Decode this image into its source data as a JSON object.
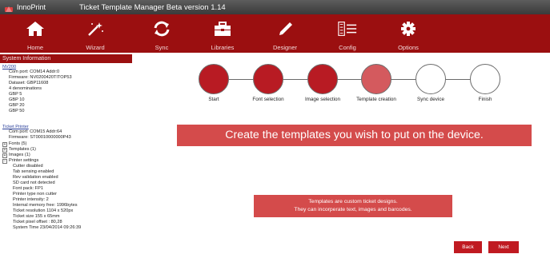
{
  "window": {
    "app_name": "InnoPrint",
    "title": "Ticket Template Manager Beta version 1.14"
  },
  "toolbar": {
    "items": [
      {
        "label": "Home",
        "icon": "home-icon"
      },
      {
        "label": "Wizard",
        "icon": "wand-icon"
      },
      {
        "label": "Sync",
        "icon": "sync-icon"
      },
      {
        "label": "Libraries",
        "icon": "briefcase-icon"
      },
      {
        "label": "Designer",
        "icon": "pen-icon"
      },
      {
        "label": "Config",
        "icon": "config-list-icon"
      },
      {
        "label": "Options",
        "icon": "gear-icon"
      }
    ]
  },
  "sidebar": {
    "header": "System Information",
    "nv200": {
      "title": "NV200",
      "lines": [
        "Com port: COM14 Addr:0",
        "Firmware: NV0200420TITOP53",
        "Dataset: GBP11608",
        "4 denominations",
        "GBP 5",
        "GBP 10",
        "GBP 20",
        "GBP 50"
      ]
    },
    "printer": {
      "title": "Ticket Printer",
      "lines": [
        "Com port: COM15 Addr:64",
        "Firmware: ST00010000000P43"
      ],
      "tree": [
        "Fonts (5)",
        "Templates (1)",
        "Images (1)",
        "Printer settings"
      ],
      "settings": [
        "Cutter disabled",
        "Tab sensing enabled",
        "Rev validation enabled",
        "SD card not detected",
        "Font pack: FP1",
        "Printer type non cutter",
        "Printer intensity: 2",
        "Internal memory free: 1996bytes",
        "Ticket resolution 1104 x 520px",
        "Ticket size 155 x 65mm",
        "Ticket pixel offset : 80,28",
        "System Time 23/04/2014 09:26:39"
      ]
    }
  },
  "wizard": {
    "steps": [
      {
        "label": "Start",
        "state": "done"
      },
      {
        "label": "Font selection",
        "state": "done"
      },
      {
        "label": "Image selection",
        "state": "done"
      },
      {
        "label": "Template creation",
        "state": "current"
      },
      {
        "label": "Sync device",
        "state": "todo"
      },
      {
        "label": "Finish",
        "state": "todo"
      }
    ],
    "banner": "Create the templates you wish to put on the device.",
    "info_line1": "Templates are custom ticket designs.",
    "info_line2": "They can incorperate text, images and barcodes."
  },
  "buttons": {
    "back": "Back",
    "next": "Next"
  },
  "colors": {
    "toolbar": "#9b0f10",
    "step_done": "#b81b23",
    "step_current": "#d45a5e",
    "banner": "#d44b4b"
  }
}
